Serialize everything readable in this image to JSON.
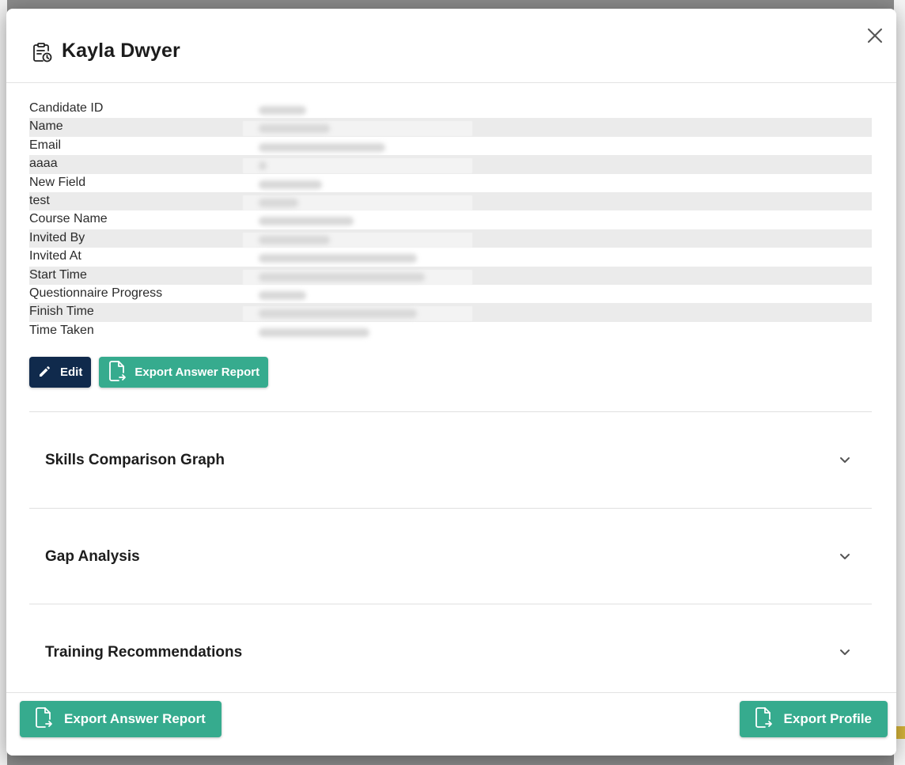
{
  "modal": {
    "title": "Kayla Dwyer",
    "title_icon": "clipboard-clock-icon",
    "close_icon": "close-icon"
  },
  "details": {
    "rows": [
      {
        "label": "Candidate ID"
      },
      {
        "label": "Name"
      },
      {
        "label": "Email"
      },
      {
        "label": "aaaa"
      },
      {
        "label": "New Field"
      },
      {
        "label": "test"
      },
      {
        "label": "Course Name"
      },
      {
        "label": "Invited By"
      },
      {
        "label": "Invited At"
      },
      {
        "label": "Start Time"
      },
      {
        "label": "Questionnaire Progress"
      },
      {
        "label": "Finish Time"
      },
      {
        "label": "Time Taken"
      }
    ]
  },
  "actions": {
    "edit_label": "Edit",
    "export_answer_label": "Export Answer Report"
  },
  "sections": [
    {
      "title": "Skills Comparison Graph"
    },
    {
      "title": "Gap Analysis"
    },
    {
      "title": "Training Recommendations"
    }
  ],
  "footer": {
    "export_answer_label": "Export Answer Report",
    "export_profile_label": "Export Profile"
  },
  "colors": {
    "primary_dark": "#102a4c",
    "accent_green": "#36ab8e",
    "row_shade": "#ebebeb",
    "overlay": "#8a8a8a"
  }
}
